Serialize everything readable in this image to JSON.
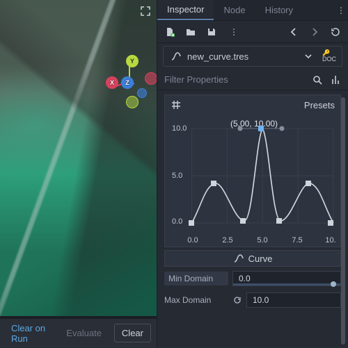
{
  "inspector": {
    "tabs": {
      "inspector": "Inspector",
      "node": "Node",
      "history": "History"
    },
    "resource_name": "new_curve.tres",
    "filter_placeholder": "Filter Properties",
    "presets_label": "Presets",
    "curve_section": "Curve",
    "coord_label": "(5.00, 10.00)",
    "min_domain": {
      "label": "Min Domain",
      "value": "0.0"
    },
    "max_domain": {
      "label": "Max Domain",
      "value": "10.0"
    },
    "yticks": {
      "t10": "10.0",
      "t5": "5.0",
      "t0": "0.0"
    },
    "xticks": {
      "x0": "0.0",
      "x25": "2.5",
      "x5": "5.0",
      "x75": "7.5",
      "x10": "10."
    }
  },
  "bottom": {
    "clear_on_run": "Clear on Run",
    "evaluate": "Evaluate",
    "clear": "Clear"
  },
  "gizmo": {
    "x": "X",
    "y": "Y",
    "z": "Z"
  },
  "chart_data": {
    "type": "line",
    "title": "",
    "xlabel": "",
    "ylabel": "",
    "xlim": [
      0,
      10
    ],
    "ylim": [
      0,
      10
    ],
    "xticks": [
      0.0,
      2.5,
      5.0,
      7.5,
      10.0
    ],
    "yticks": [
      0.0,
      5.0,
      10.0
    ],
    "selected_point": {
      "x": 5.0,
      "y": 10.0
    },
    "points": [
      {
        "x": 0.0,
        "y": 0.0
      },
      {
        "x": 1.6,
        "y": 4.2
      },
      {
        "x": 3.7,
        "y": 0.2
      },
      {
        "x": 5.0,
        "y": 10.0
      },
      {
        "x": 6.3,
        "y": 0.2
      },
      {
        "x": 8.4,
        "y": 4.2
      },
      {
        "x": 10.0,
        "y": 0.0
      }
    ]
  }
}
